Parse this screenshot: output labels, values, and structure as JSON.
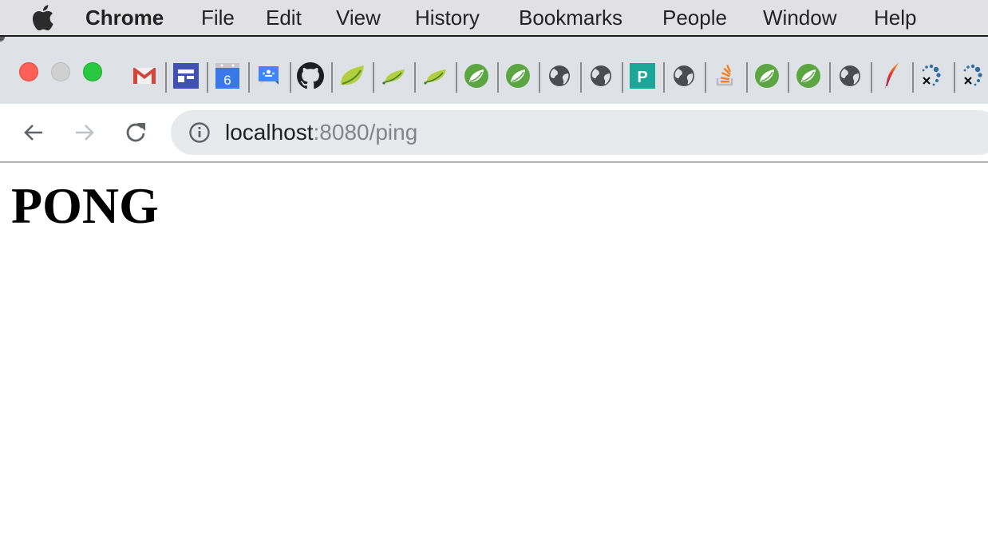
{
  "menubar": {
    "app_name": "Chrome",
    "items": [
      "File",
      "Edit",
      "View",
      "History",
      "Bookmarks",
      "People",
      "Window",
      "Help"
    ]
  },
  "window_controls": {
    "close": "close-window",
    "minimize": "minimize-window",
    "maximize": "maximize-window"
  },
  "bookmarks": [
    {
      "icon": "gmail-icon",
      "color": "#d44638"
    },
    {
      "icon": "google-sites-icon",
      "color": "#3f51b5"
    },
    {
      "icon": "google-calendar-icon",
      "color": "#3b78e7",
      "text": "6"
    },
    {
      "icon": "google-classroom-icon",
      "color": "#4285f4"
    },
    {
      "icon": "github-icon",
      "color": "#1b1f23"
    },
    {
      "icon": "spring-leaf-icon",
      "color": "#a8c83a"
    },
    {
      "icon": "spring-leaf-icon",
      "color": "#a8c83a"
    },
    {
      "icon": "spring-leaf-icon",
      "color": "#a8c83a"
    },
    {
      "icon": "spring-io-icon",
      "color": "#5ba641"
    },
    {
      "icon": "spring-io-icon",
      "color": "#5ba641"
    },
    {
      "icon": "globe-icon",
      "color": "#4a4c50"
    },
    {
      "icon": "globe-icon",
      "color": "#4a4c50"
    },
    {
      "icon": "pivotal-icon",
      "color": "#1aa799",
      "text": "P"
    },
    {
      "icon": "globe-icon",
      "color": "#4a4c50"
    },
    {
      "icon": "stackoverflow-icon",
      "color": "#f48024"
    },
    {
      "icon": "spring-io-icon",
      "color": "#5ba641"
    },
    {
      "icon": "spring-io-icon",
      "color": "#5ba641"
    },
    {
      "icon": "globe-icon",
      "color": "#4a4c50"
    },
    {
      "icon": "apache-feather-icon",
      "color": "#c2185b"
    },
    {
      "icon": "dots-x-icon",
      "color": "#2f6f9f"
    },
    {
      "icon": "dots-x-icon",
      "color": "#2f6f9f"
    }
  ],
  "toolbar": {
    "back": "back",
    "forward": "forward",
    "reload": "reload"
  },
  "omnibox": {
    "url_host": "localhost",
    "url_rest": ":8080/ping"
  },
  "page": {
    "heading": "PONG"
  }
}
